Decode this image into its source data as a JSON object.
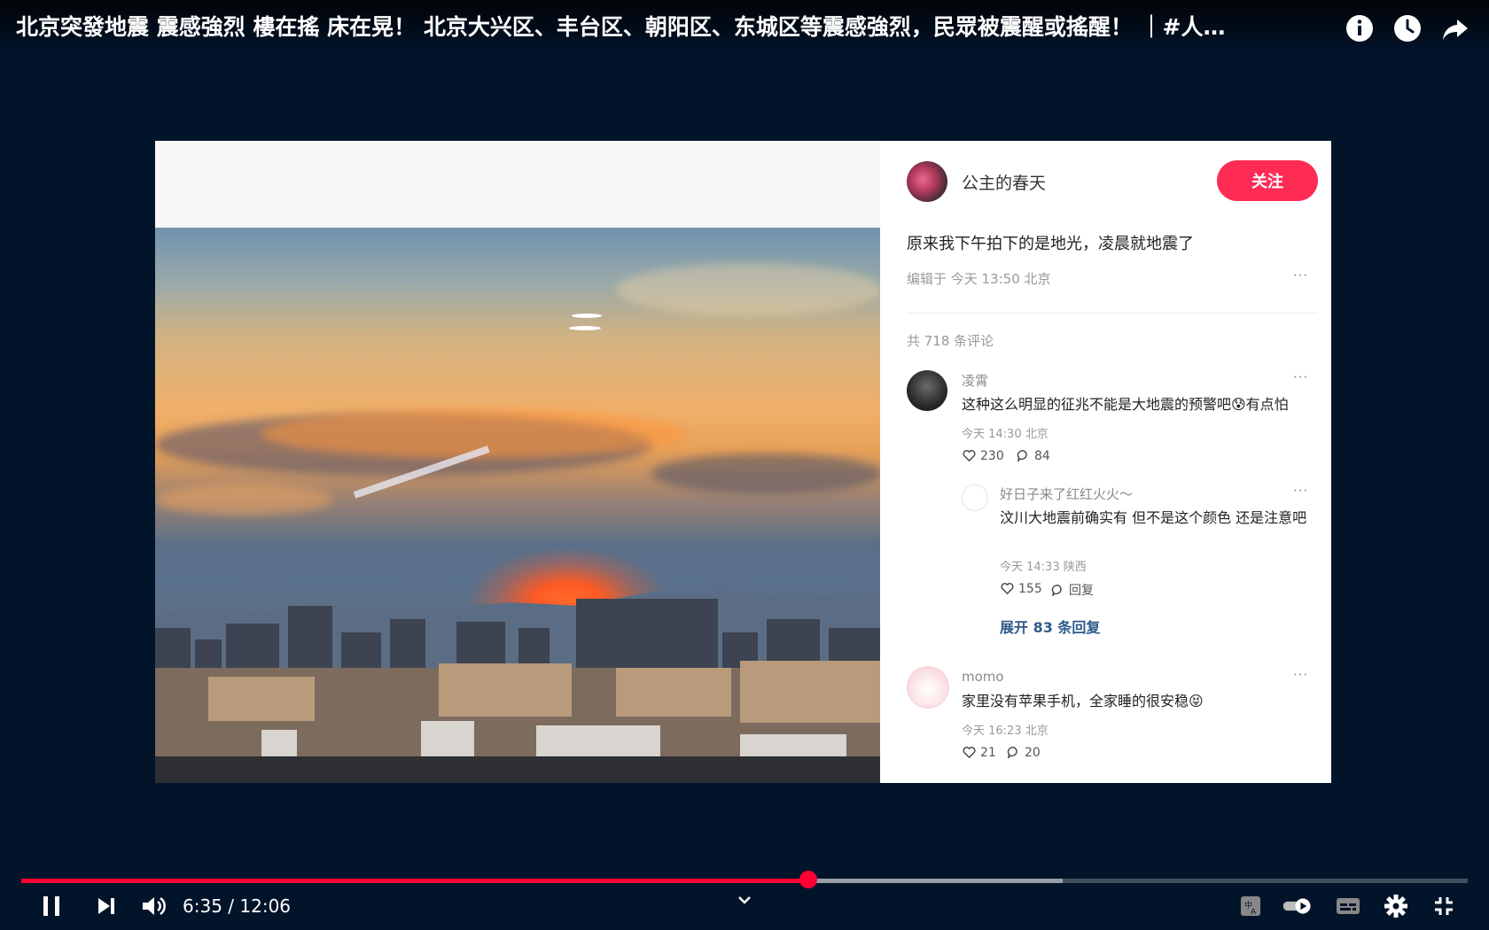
{
  "video": {
    "title": "北京突發地震 震感強烈 樓在搖 床在晃！ 北京大兴区、丰台区、朝阳区、东城区等震感強烈，民眾被震醒或搖醒！ ｜#人…",
    "top_icons": [
      "info-icon",
      "watch-later-icon",
      "share-icon"
    ]
  },
  "post": {
    "username": "公主的春天",
    "follow_label": "关注",
    "text": "原来我下午拍下的是地光，凌晨就地震了",
    "meta": "编辑于 今天 13:50 北京",
    "more": "···",
    "comment_count": "共 718 条评论"
  },
  "comments": [
    {
      "name": "凌霄",
      "text": "这种这么明显的征兆不能是大地震的预警吧😰有点怕",
      "meta": "今天 14:30 北京",
      "likes": "230",
      "replies": "84"
    },
    {
      "name": "好日子来了红红火火～",
      "text": "汶川大地震前确实有 但不是这个颜色 还是注意吧",
      "meta": "今天 14:33 陕西",
      "likes": "155",
      "replies": "回复"
    },
    {
      "name": "momo",
      "text": "家里没有苹果手机，全家睡的很安稳😝",
      "meta": "今天 16:23 北京",
      "likes": "21",
      "replies": "20"
    }
  ],
  "expand_replies": "展开 83 条回复",
  "player": {
    "current_time": "6:35",
    "separator": " / ",
    "duration": "12:06",
    "played_fraction": 0.544,
    "buffered_fraction": 0.72,
    "accent_color": "#ff0033",
    "icons": [
      "pause-icon",
      "next-icon",
      "volume-icon",
      "chevron-down-icon",
      "translate-icon",
      "autoplay-toggle-icon",
      "subtitles-icon",
      "settings-icon",
      "exit-fullscreen-icon"
    ]
  }
}
